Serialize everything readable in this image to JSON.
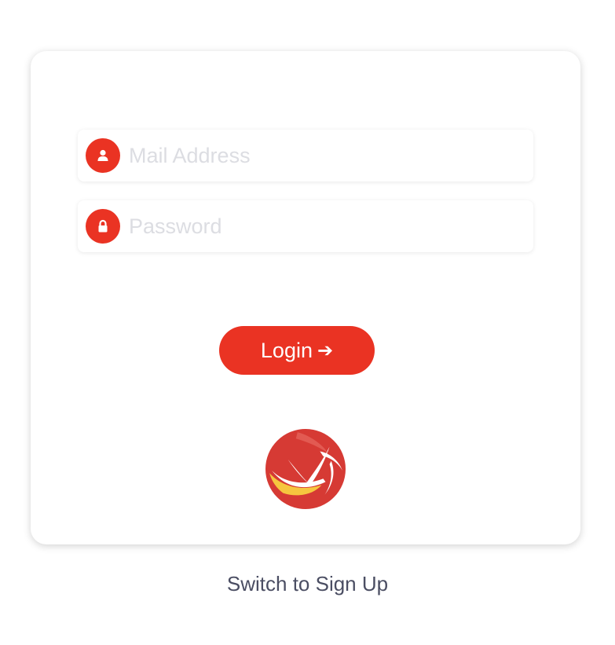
{
  "login_form": {
    "mail_field": {
      "placeholder": "Mail Address",
      "value": "",
      "icon": "user-icon"
    },
    "password_field": {
      "placeholder": "Password",
      "value": "",
      "icon": "lock-icon"
    },
    "login_button": {
      "label": "Login",
      "icon": "arrow-right-icon"
    }
  },
  "switch_link": {
    "label": "Switch to Sign Up"
  },
  "colors": {
    "accent": "#ea3323",
    "placeholder": "#dcdde2",
    "link_text": "#4b4e63"
  }
}
